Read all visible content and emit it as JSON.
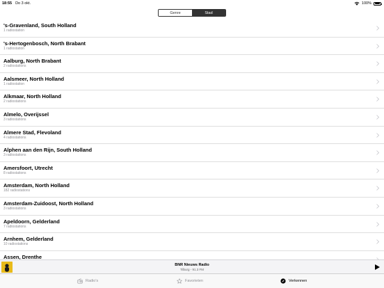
{
  "status_bar": {
    "time": "18:55",
    "date": "Do 3 okt.",
    "battery": "100%"
  },
  "segmented_control": {
    "genre_label": "Genre",
    "city_label": "Stad"
  },
  "cities": [
    {
      "name": "'s-Gravenland, South Holland",
      "count": "1 radiostation"
    },
    {
      "name": "'s-Hertogenbosch, North Brabant",
      "count": "1 radiostation"
    },
    {
      "name": "Aalburg, North Brabant",
      "count": "2 radiostations"
    },
    {
      "name": "Aalsmeer, North Holland",
      "count": "1 radiostation"
    },
    {
      "name": "Alkmaar, North Holland",
      "count": "2 radiostations"
    },
    {
      "name": "Almelo, Overijssel",
      "count": "3 radiostations"
    },
    {
      "name": "Almere Stad, Flevoland",
      "count": "4 radiostations"
    },
    {
      "name": "Alphen aan den Rijn, South Holland",
      "count": "3 radiostations"
    },
    {
      "name": "Amersfoort, Utrecht",
      "count": "8 radiostations"
    },
    {
      "name": "Amsterdam, North Holland",
      "count": "182 radiostations"
    },
    {
      "name": "Amsterdam-Zuidoost, North Holland",
      "count": "3 radiostations"
    },
    {
      "name": "Apeldoorn, Gelderland",
      "count": "7 radiostations"
    },
    {
      "name": "Arnhem, Gelderland",
      "count": "10 radiostations"
    },
    {
      "name": "Assen, Drenthe",
      "count": ""
    }
  ],
  "player": {
    "title": "BNR Nieuws Radio",
    "subtitle": "Tilburg - 91.3 FM"
  },
  "tabbar": {
    "radios_label": "Radio's",
    "favorites_label": "Favorieten",
    "explore_label": "Verkennen"
  }
}
